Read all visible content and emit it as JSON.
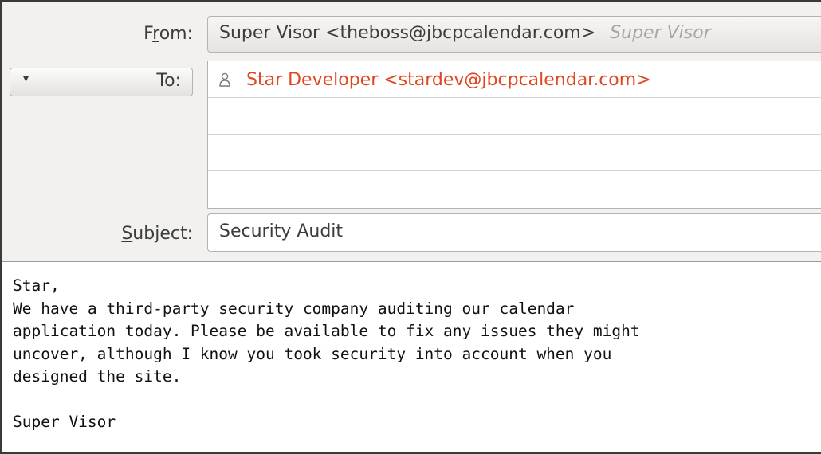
{
  "header": {
    "from_label": "From:",
    "from_value": "Super Visor <theboss@jbcpcalendar.com>",
    "from_alias": "Super Visor",
    "to_label": "To:",
    "to_dropdown_glyph": "▾",
    "recipients": [
      {
        "address": "Star Developer <stardev@jbcpcalendar.com>",
        "icon": "person-icon"
      },
      {
        "address": ""
      },
      {
        "address": ""
      },
      {
        "address": ""
      }
    ],
    "subject_label": "Subject:",
    "subject_value": "Security Audit"
  },
  "message": {
    "lines": [
      "Star,",
      "We have a third-party security company auditing our calendar",
      "application today. Please be available to fix any issues they might",
      "uncover, although I know you took security into account when you",
      "designed the site.",
      "",
      "Super Visor"
    ]
  },
  "colors": {
    "recipient": "#e0461f",
    "header_bg": "#f2f1f0",
    "alias": "#a9a7a4"
  }
}
